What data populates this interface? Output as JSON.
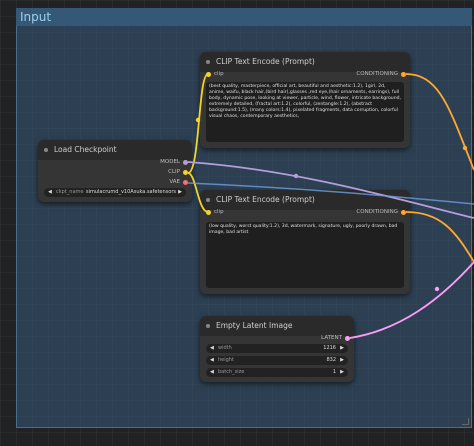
{
  "group": {
    "title": "Input"
  },
  "nodes": {
    "clip_pos": {
      "title": "CLIP Text Encode (Prompt)",
      "input_label": "clip",
      "output_label": "CONDITIONING",
      "text": "(best quality, masterpiece, official art, beautiful and aesthetic:1.2), 1girl, 2d, anime, waifu, black hair,(bird hair),glasses ,red eye,(hair ornaments, earrings), full body, dynamic pose, looking at viewer, particle, wind, flower, intricate background, extremely detailed, (fractal art:1.2), colorful, (zentangle:1.2), (abstract background:1.5), (many colors:1.4), pixelated fragments, data corruption, colorful visual chaos, contemporary aesthetics,"
    },
    "load_checkpoint": {
      "title": "Load Checkpoint",
      "outputs": [
        "MODEL",
        "CLIP",
        "VAE"
      ],
      "ckpt_label": "ckpt_name",
      "ckpt_value": "simulacrumd_v10Asuka.safetensors"
    },
    "clip_neg": {
      "title": "CLIP Text Encode (Prompt)",
      "input_label": "clip",
      "output_label": "CONDITIONING",
      "text": "(low quality, worst quality:1.2), 3d, watermark, signature, ugly, poorly drawn, bad image, bad artist"
    },
    "empty_latent": {
      "title": "Empty Latent Image",
      "output_label": "LATENT",
      "widgets": [
        {
          "name": "width",
          "value": "1216"
        },
        {
          "name": "height",
          "value": "832"
        },
        {
          "name": "batch_size",
          "value": "1"
        }
      ]
    }
  },
  "colors": {
    "clip_link": "#f5d428",
    "model_link": "#b39ddb",
    "conditioning_link": "#ffa931",
    "latent_link": "#ff9cf9",
    "vae_link": "#ff6e6e"
  }
}
